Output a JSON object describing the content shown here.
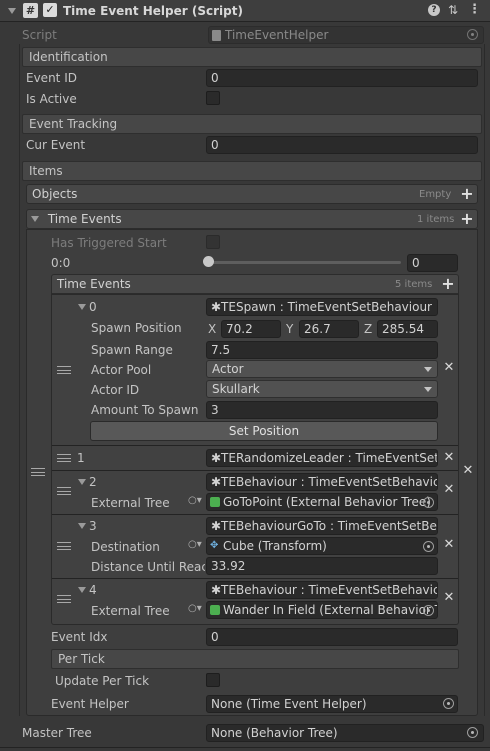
{
  "component": {
    "title": "Time Event Helper (Script)",
    "enabled": true,
    "script_label": "Script",
    "script_value": "TimeEventHelper"
  },
  "identification": {
    "header": "Identification",
    "event_id_label": "Event ID",
    "event_id_value": "0",
    "is_active_label": "Is Active"
  },
  "tracking": {
    "header": "Event Tracking",
    "cur_event_label": "Cur Event",
    "cur_event_value": "0"
  },
  "items": {
    "header": "Items",
    "objects_label": "Objects",
    "objects_count": "Empty",
    "time_events_label": "Time Events",
    "time_events_count": "1 items",
    "has_triggered_label": "Has Triggered Start",
    "slider_label": "0:0",
    "slider_value": "0",
    "slider_fraction": 0,
    "inner_header": "Time Events",
    "inner_count": "5 items"
  },
  "events": [
    {
      "index": "0",
      "ref": "✱TESpawn : TimeEventSetBehaviour",
      "spawn_position_label": "Spawn Position",
      "x_label": "X",
      "x": "70.2",
      "y_label": "Y",
      "y": "26.7",
      "z_label": "Z",
      "z": "285.54",
      "spawn_range_label": "Spawn Range",
      "spawn_range": "7.5",
      "actor_pool_label": "Actor Pool",
      "actor_pool": "Actor",
      "actor_id_label": "Actor ID",
      "actor_id": "Skullark",
      "amount_label": "Amount To Spawn",
      "amount": "3",
      "set_position_button": "Set Position"
    },
    {
      "index": "1",
      "ref": "✱TERandomizeLeader : TimeEventSet"
    },
    {
      "index": "2",
      "ref": "✱TEBehaviour : TimeEventSetBehavic",
      "field_label": "External Tree",
      "field_value": "GoToPoint (External Behavior Tree)"
    },
    {
      "index": "3",
      "ref": "✱TEBehaviourGoTo : TimeEventSetBe",
      "field_label": "Destination",
      "field_value": "Cube (Transform)",
      "distance_label": "Distance Until Reach",
      "distance_value": "33.92"
    },
    {
      "index": "4",
      "ref": "✱TEBehaviour : TimeEventSetBehavic",
      "field_label": "External Tree",
      "field_value": "Wander In Field (External Behavior T"
    }
  ],
  "footer": {
    "event_idx_label": "Event Idx",
    "event_idx_value": "0",
    "per_tick_header": "Per Tick",
    "update_per_tick_label": "Update Per Tick",
    "event_helper_label": "Event Helper",
    "event_helper_value": "None (Time Event Helper)",
    "master_tree_label": "Master Tree",
    "master_tree_value": "None (Behavior Tree)"
  },
  "icons": {
    "x_glyph": "✕",
    "plus_glyph": "+",
    "search_glyph": "○▾",
    "help_glyph": "?",
    "menu_glyph": "⋮",
    "settings_glyph": "⇅"
  },
  "colors": {
    "background": "#383838",
    "field": "#2a2a2a",
    "header": "#474747",
    "accent_green": "#4caf50"
  }
}
